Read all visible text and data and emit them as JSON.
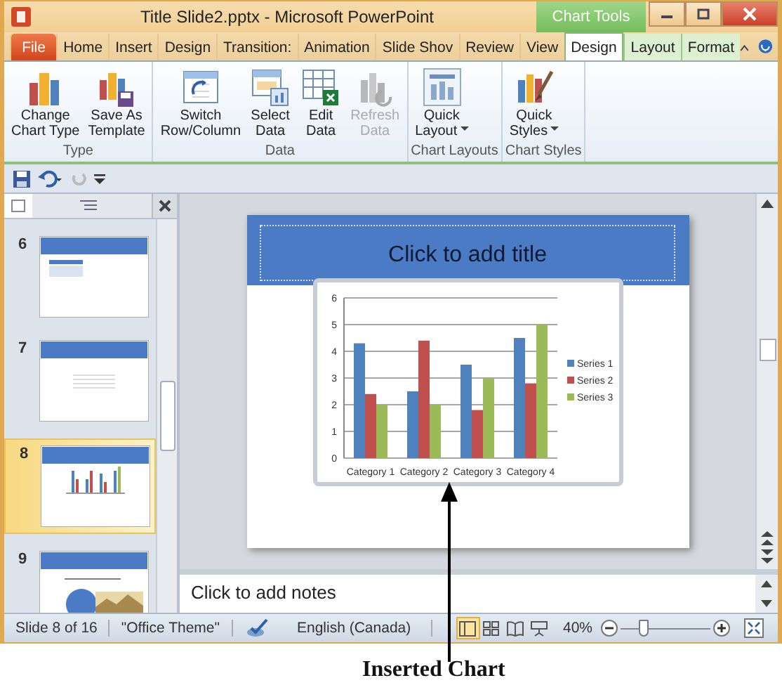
{
  "window": {
    "title": "Title Slide2.pptx  -  Microsoft PowerPoint",
    "contextual_tab": "Chart Tools"
  },
  "tabs": [
    {
      "label": "File",
      "kind": "file",
      "selected": false
    },
    {
      "label": "Home",
      "kind": "normal",
      "selected": false
    },
    {
      "label": "Insert",
      "kind": "normal",
      "selected": false
    },
    {
      "label": "Design",
      "kind": "normal",
      "selected": false
    },
    {
      "label": "Transition:",
      "kind": "normal",
      "selected": false
    },
    {
      "label": "Animation",
      "kind": "normal",
      "selected": false
    },
    {
      "label": "Slide Shov",
      "kind": "normal",
      "selected": false
    },
    {
      "label": "Review",
      "kind": "normal",
      "selected": false
    },
    {
      "label": "View",
      "kind": "normal",
      "selected": false
    },
    {
      "label": "Design",
      "kind": "contextual",
      "selected": true
    },
    {
      "label": "Layout",
      "kind": "contextual",
      "selected": false
    },
    {
      "label": "Format",
      "kind": "contextual",
      "selected": false
    }
  ],
  "ribbon_groups": [
    {
      "label": "Type",
      "buttons": [
        {
          "label": "Change\nChart Type",
          "disabled": false,
          "dropdown": false
        },
        {
          "label": "Save As\nTemplate",
          "disabled": false,
          "dropdown": false
        }
      ]
    },
    {
      "label": "Data",
      "buttons": [
        {
          "label": "Switch\nRow/Column",
          "disabled": false,
          "dropdown": false
        },
        {
          "label": "Select\nData",
          "disabled": false,
          "dropdown": false
        },
        {
          "label": "Edit\nData",
          "disabled": false,
          "dropdown": false
        },
        {
          "label": "Refresh\nData",
          "disabled": true,
          "dropdown": false
        }
      ]
    },
    {
      "label": "Chart Layouts",
      "buttons": [
        {
          "label": "Quick\nLayout",
          "disabled": false,
          "dropdown": true
        }
      ]
    },
    {
      "label": "Chart Styles",
      "buttons": [
        {
          "label": "Quick\nStyles",
          "disabled": false,
          "dropdown": true
        }
      ]
    }
  ],
  "thumbnails": [
    {
      "number": "6",
      "kind": "table",
      "selected": false
    },
    {
      "number": "7",
      "kind": "grid",
      "selected": false
    },
    {
      "number": "8",
      "kind": "chart",
      "selected": true
    },
    {
      "number": "9",
      "kind": "picture",
      "selected": false
    }
  ],
  "slide": {
    "title_placeholder": "Click to add title",
    "chart_data": {
      "type": "bar",
      "categories": [
        "Category 1",
        "Category 2",
        "Category 3",
        "Category 4"
      ],
      "series": [
        {
          "name": "Series 1",
          "color": "#4f81bd",
          "values": [
            4.3,
            2.5,
            3.5,
            4.5
          ]
        },
        {
          "name": "Series 2",
          "color": "#c0504d",
          "values": [
            2.4,
            4.4,
            1.8,
            2.8
          ]
        },
        {
          "name": "Series 3",
          "color": "#9bbb59",
          "values": [
            2,
            2,
            3,
            5
          ]
        }
      ],
      "ylim": [
        0,
        6
      ],
      "yticks": [
        0,
        1,
        2,
        3,
        4,
        5,
        6
      ],
      "grid": true,
      "legend": true
    }
  },
  "notes": {
    "placeholder": "Click to add notes"
  },
  "status_bar": {
    "slide": "Slide 8 of 16",
    "theme": "\"Office Theme\"",
    "language": "English (Canada)",
    "zoom": "40%",
    "views": [
      {
        "kind": "normal",
        "selected": true
      },
      {
        "kind": "sorter",
        "selected": false
      },
      {
        "kind": "reading",
        "selected": false
      },
      {
        "kind": "slideshow",
        "selected": false
      }
    ],
    "zoom_slider": {
      "level": 0.25
    }
  },
  "annotation": {
    "label": "Inserted Chart"
  }
}
